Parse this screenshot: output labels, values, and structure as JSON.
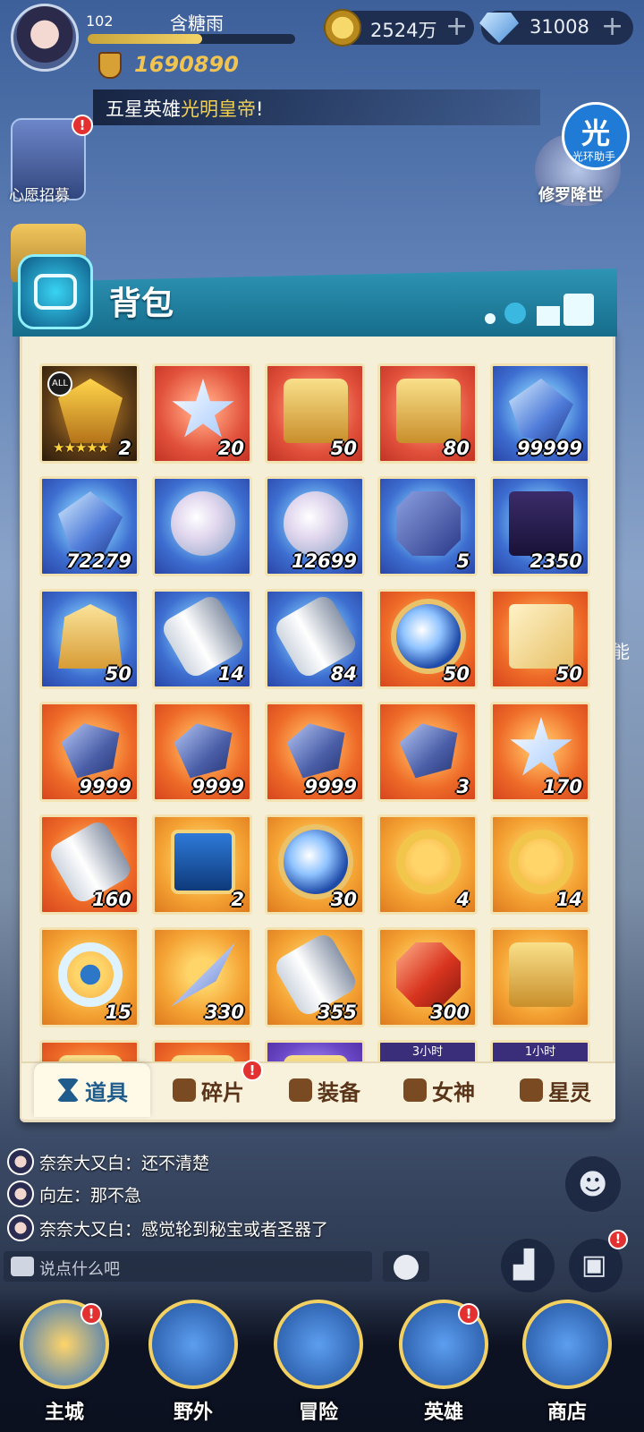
{
  "player": {
    "level": "102",
    "name": "含糖雨",
    "exp_fraction": 0.55,
    "power": "1690890"
  },
  "resources": {
    "gold": "2524万",
    "gems": "31008",
    "plus": "+"
  },
  "broadcast": {
    "prefix": "五星英雄",
    "highlight": "光明皇帝",
    "suffix": "!"
  },
  "side": {
    "wish_label": "心愿招募",
    "event_label": "修罗降世",
    "assist_glyph": "光",
    "assist_label": "光环助手",
    "side_char": "能"
  },
  "badge": "!",
  "bag": {
    "title": "背包",
    "items": [
      {
        "count": "2",
        "bg": "bg-dark",
        "art": "mask",
        "all": "ALL",
        "stars": "★★★★★"
      },
      {
        "count": "20",
        "bg": "bg-red",
        "art": "star"
      },
      {
        "count": "50",
        "bg": "bg-red",
        "art": "chest"
      },
      {
        "count": "80",
        "bg": "bg-red",
        "art": "chest"
      },
      {
        "count": "99999",
        "bg": "bg-blue",
        "art": "crystal"
      },
      {
        "count": "72279",
        "bg": "bg-blue",
        "art": "crystal"
      },
      {
        "count": "",
        "bg": "bg-blue",
        "art": "fruit"
      },
      {
        "count": "12699",
        "bg": "bg-blue",
        "art": "fruit"
      },
      {
        "count": "5",
        "bg": "bg-blue",
        "art": "seal"
      },
      {
        "count": "2350",
        "bg": "bg-blue",
        "art": "scroll"
      },
      {
        "count": "50",
        "bg": "bg-blue",
        "art": "armor"
      },
      {
        "count": "14",
        "bg": "bg-blue",
        "art": "canister"
      },
      {
        "count": "84",
        "bg": "bg-blue",
        "art": "canister"
      },
      {
        "count": "50",
        "bg": "bg-orange",
        "art": "orb"
      },
      {
        "count": "50",
        "bg": "bg-orange",
        "art": "cube"
      },
      {
        "count": "9999",
        "bg": "bg-orange",
        "art": "stone"
      },
      {
        "count": "9999",
        "bg": "bg-orange",
        "art": "stone"
      },
      {
        "count": "9999",
        "bg": "bg-orange",
        "art": "stone"
      },
      {
        "count": "3",
        "bg": "bg-orange",
        "art": "stone"
      },
      {
        "count": "170",
        "bg": "bg-orange",
        "art": "star"
      },
      {
        "count": "160",
        "bg": "bg-orange",
        "art": "canister"
      },
      {
        "count": "2",
        "bg": "bg-yellow",
        "art": "card"
      },
      {
        "count": "30",
        "bg": "bg-yellow",
        "art": "orb"
      },
      {
        "count": "4",
        "bg": "bg-yellow",
        "art": "ring"
      },
      {
        "count": "14",
        "bg": "bg-yellow",
        "art": "ring"
      },
      {
        "count": "15",
        "bg": "bg-yellow",
        "art": "wheel"
      },
      {
        "count": "330",
        "bg": "bg-yellow",
        "art": "blade"
      },
      {
        "count": "355",
        "bg": "bg-yellow",
        "art": "canister"
      },
      {
        "count": "300",
        "bg": "bg-yellow",
        "art": "gem"
      },
      {
        "count": "",
        "bg": "bg-yellow",
        "art": "chest"
      },
      {
        "count": "",
        "bg": "bg-orange",
        "art": "chest"
      },
      {
        "count": "",
        "bg": "bg-orange",
        "art": "chest"
      },
      {
        "count": "",
        "bg": "bg-purple",
        "art": "chest"
      },
      {
        "count": "",
        "bg": "bg-purple",
        "art": "chest",
        "timer": "3小时"
      },
      {
        "count": "",
        "bg": "bg-purple",
        "art": "chest",
        "timer": "1小时"
      }
    ]
  },
  "tabs": [
    {
      "label": "道具",
      "active": true
    },
    {
      "label": "碎片"
    },
    {
      "label": "装备"
    },
    {
      "label": "女神"
    },
    {
      "label": "星灵"
    }
  ],
  "chat": [
    {
      "name": "奈奈大又白",
      "msg": "还不清楚"
    },
    {
      "name": "向左",
      "msg": "那不急"
    },
    {
      "name": "奈奈大又白",
      "msg": "感觉轮到秘宝或者圣器了"
    }
  ],
  "chat_input": {
    "placeholder": "说点什么吧"
  },
  "nav": [
    "主城",
    "野外",
    "冒险",
    "英雄",
    "商店"
  ]
}
